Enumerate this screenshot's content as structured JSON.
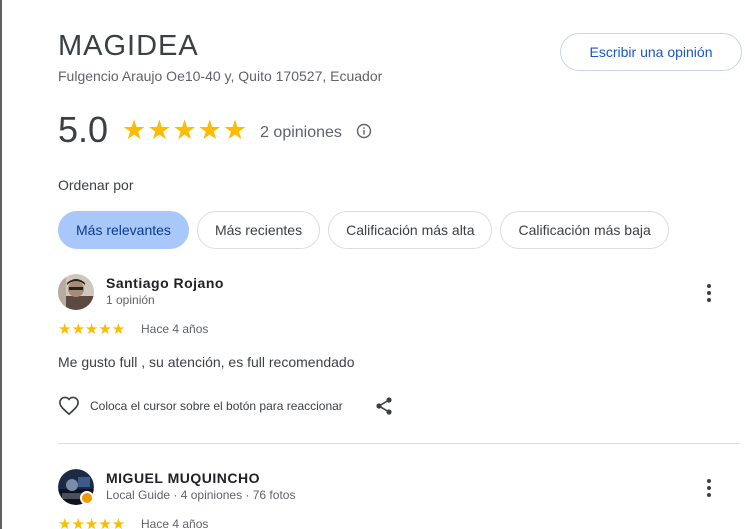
{
  "place": {
    "name": "MAGIDEA",
    "address": "Fulgencio Araujo Oe10-40 y, Quito 170527, Ecuador",
    "rating": "5.0",
    "stars": "★★★★★",
    "review_count": "2 opiniones",
    "write_review_label": "Escribir una opinión"
  },
  "sort": {
    "label": "Ordenar por",
    "chips": [
      "Más relevantes",
      "Más recientes",
      "Calificación más alta",
      "Calificación más baja"
    ],
    "active_index": 0
  },
  "reviews": [
    {
      "name": "Santiago Rojano",
      "meta": "1 opinión",
      "stars": "★★★★★",
      "when": "Hace 4 años",
      "text": "Me gusto full , su atención, es full recomendado",
      "react_label": "Coloca el cursor sobre el botón para reaccionar"
    },
    {
      "name": "MIGUEL MUQUINCHO",
      "meta": "Local Guide · 4 opiniones · 76 fotos",
      "stars": "★★★★★",
      "when": "Hace 4 años"
    }
  ],
  "colors": {
    "star": "#fbbc04",
    "active_chip": "#a8c7fa",
    "link": "#1a56c8"
  }
}
